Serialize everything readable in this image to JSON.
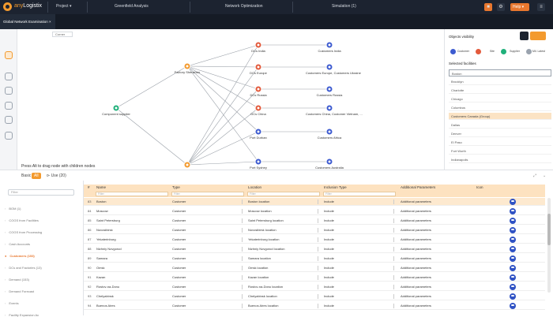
{
  "app": {
    "logo_prefix": "any",
    "logo_name": "Logistix"
  },
  "topbar": {
    "project_menu": "Project ▾",
    "tab1": "Greenfield Analysis",
    "tab2": "Network Optimization",
    "tab3": "Simulation (1)",
    "help_label": "Help ▾"
  },
  "subbar": {
    "scenario_tab": "Global Network Examination ×"
  },
  "canvas": {
    "corner_label": "Corner",
    "hint": "Press Alt to drag node with children nodes",
    "nodes": [
      {
        "label": "Component supplier",
        "type": "supplier"
      },
      {
        "label": "Factory Shenzhen",
        "type": "factory"
      },
      {
        "label": "DCs India",
        "type": "dc"
      },
      {
        "label": "DCs Europe",
        "type": "dc"
      },
      {
        "label": "DCs Russia",
        "type": "dc"
      },
      {
        "label": "DCs China",
        "type": "dc"
      },
      {
        "label": "Port Durban",
        "type": "port"
      },
      {
        "label": "Port Sydney",
        "type": "port"
      },
      {
        "label": "Customers India",
        "type": "customer"
      },
      {
        "label": "Customers Europe, Customers Ukraine",
        "type": "customer"
      },
      {
        "label": "Customers Russia",
        "type": "customer"
      },
      {
        "label": "Customers China, Customer Vietnam, ...",
        "type": "customer"
      },
      {
        "label": "Customers Africa",
        "type": "customer"
      },
      {
        "label": "Customers Australia",
        "type": "customer"
      }
    ]
  },
  "right_panel": {
    "title": "Objects visibility",
    "visibility": [
      {
        "label": "Customer",
        "color": "#3d5bd0"
      },
      {
        "label": "Site",
        "color": "#e35a3c"
      },
      {
        "label": "Supplier",
        "color": "#1fb07a"
      },
      {
        "label": "Mil. Latest",
        "color": "#9aa3ae"
      }
    ],
    "facilities_title": "Selected facilities",
    "facilities": [
      "Boston",
      "Brooklyn",
      "Charlotte",
      "Chicago",
      "Columbus",
      "Customers Canada (Group)",
      "Dallas",
      "Denver",
      "El Paso",
      "Fort Worth",
      "Indianapolis"
    ],
    "highlighted_index": 5
  },
  "bottom_tabs": {
    "basic": "Basic",
    "all": "All",
    "use": "⊳ Use (20)"
  },
  "side": {
    "filter_placeholder": "Filter",
    "items": [
      {
        "label": "BOM (1)",
        "active": false
      },
      {
        "label": "COGS from Facilities",
        "active": false
      },
      {
        "label": "COGS from Processing",
        "active": false
      },
      {
        "label": "Cash Accounts",
        "active": false
      },
      {
        "label": "Customers (153)",
        "active": true
      },
      {
        "label": "DCs and Factories (13)",
        "active": false
      },
      {
        "label": "Demand (153)",
        "active": false
      },
      {
        "label": "Demand Forecast",
        "active": false
      },
      {
        "label": "Events",
        "active": false
      },
      {
        "label": "Facility Expansion Ac",
        "active": false
      }
    ]
  },
  "grid": {
    "columns": [
      "Name",
      "Type",
      "Location",
      "Inclusion Type",
      "Additional Parameters",
      "Icon"
    ],
    "filter_placeholder": "Filter",
    "rows": [
      {
        "n": "83",
        "name": "Boston",
        "type": "Customer",
        "loc": "Boston location",
        "inc": "Include",
        "add": "Additional parameters",
        "sel": true
      },
      {
        "n": "84",
        "name": "Moscow",
        "type": "Customer",
        "loc": "Moscow location",
        "inc": "Include",
        "add": "Additional parameters",
        "sel": false
      },
      {
        "n": "85",
        "name": "Saint Petersburg",
        "type": "Customer",
        "loc": "Saint Petersburg location",
        "inc": "Include",
        "add": "Additional parameters",
        "sel": false
      },
      {
        "n": "86",
        "name": "Novosibirsk",
        "type": "Customer",
        "loc": "Novosibirsk location",
        "inc": "Include",
        "add": "Additional parameters",
        "sel": false
      },
      {
        "n": "87",
        "name": "Yekaterinburg",
        "type": "Customer",
        "loc": "Yekaterinburg location",
        "inc": "Include",
        "add": "Additional parameters",
        "sel": false
      },
      {
        "n": "88",
        "name": "Nizhniy Novgorod",
        "type": "Customer",
        "loc": "Nizhniy Novgorod location",
        "inc": "Include",
        "add": "Additional parameters",
        "sel": false
      },
      {
        "n": "89",
        "name": "Samara",
        "type": "Customer",
        "loc": "Samara location",
        "inc": "Include",
        "add": "Additional parameters",
        "sel": false
      },
      {
        "n": "90",
        "name": "Omsk",
        "type": "Customer",
        "loc": "Omsk location",
        "inc": "Include",
        "add": "Additional parameters",
        "sel": false
      },
      {
        "n": "91",
        "name": "Kazan",
        "type": "Customer",
        "loc": "Kazan location",
        "inc": "Include",
        "add": "Additional parameters",
        "sel": false
      },
      {
        "n": "92",
        "name": "Rostov-na-Donu",
        "type": "Customer",
        "loc": "Rostov-na-Donu location",
        "inc": "Include",
        "add": "Additional parameters",
        "sel": false
      },
      {
        "n": "93",
        "name": "Chelyabinsk",
        "type": "Customer",
        "loc": "Chelyabinsk location",
        "inc": "Include",
        "add": "Additional parameters",
        "sel": false
      },
      {
        "n": "94",
        "name": "Buenos Aires",
        "type": "Customer",
        "loc": "Buenos Aires location",
        "inc": "Include",
        "add": "Additional parameters",
        "sel": false
      }
    ]
  }
}
